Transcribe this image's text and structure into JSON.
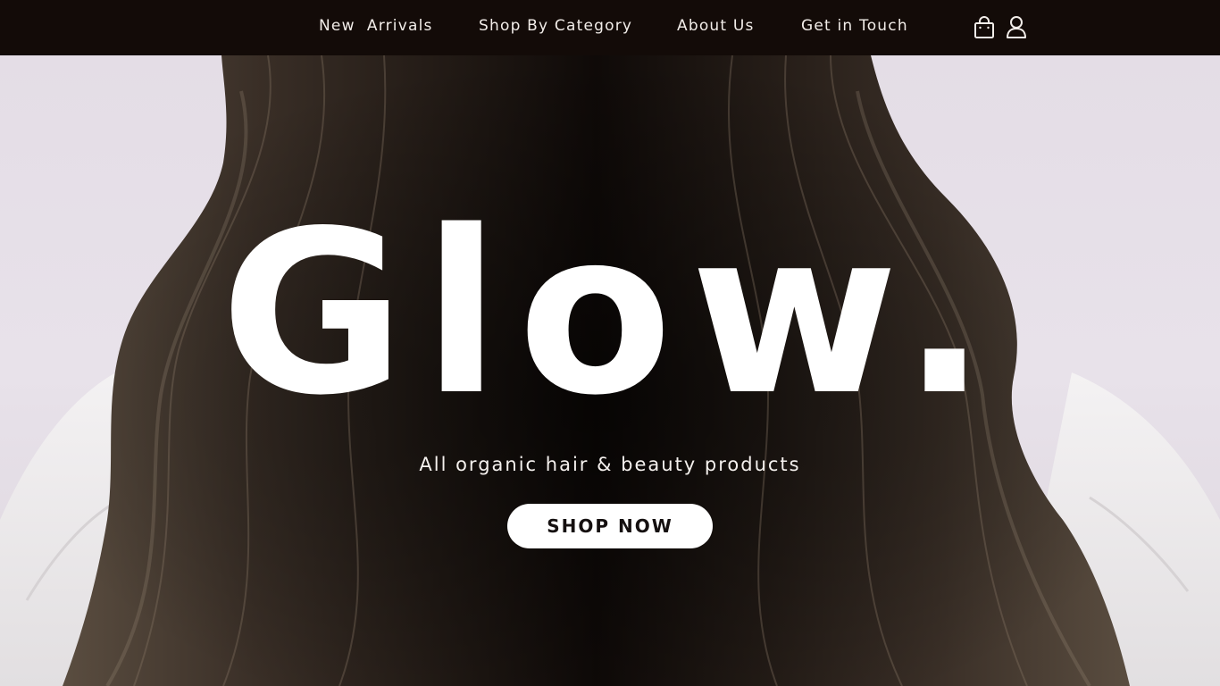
{
  "nav": {
    "links": [
      {
        "label": "New  Arrivals"
      },
      {
        "label": "Shop By Category"
      },
      {
        "label": "About Us"
      },
      {
        "label": "Get in Touch"
      }
    ],
    "icons": [
      "shopping-bag-icon",
      "user-account-icon"
    ]
  },
  "hero": {
    "title": "Glow.",
    "subtitle": "All organic hair & beauty products",
    "cta_label": "SHOP NOW"
  },
  "colors": {
    "nav_background": "#130b08",
    "nav_text": "#f2ede9",
    "backdrop": "#e6e0e6",
    "hair": "#2a211b",
    "title_text": "#ffffff",
    "button_background": "#ffffff",
    "button_text": "#151010"
  }
}
